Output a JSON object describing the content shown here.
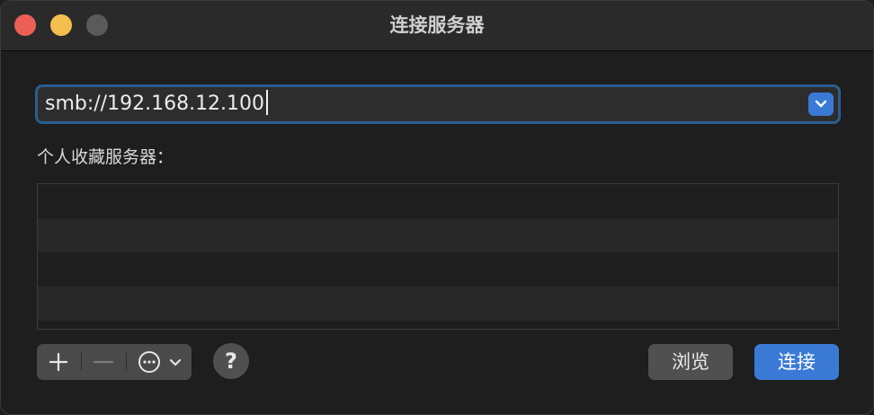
{
  "window": {
    "title": "连接服务器"
  },
  "address": {
    "value": "smb://192.168.12.100"
  },
  "favorites": {
    "label": "个人收藏服务器：",
    "rows": [
      "",
      "",
      "",
      ""
    ]
  },
  "toolbar": {
    "add_icon": "plus-icon",
    "remove_icon": "minus-icon",
    "actions_icon": "ellipsis-circle-icon",
    "help_label": "?"
  },
  "buttons": {
    "browse": "浏览",
    "connect": "连接"
  },
  "colors": {
    "accent": "#3a7ad6",
    "focus_ring": "#2a5d8f",
    "background": "#1e1e1e"
  }
}
